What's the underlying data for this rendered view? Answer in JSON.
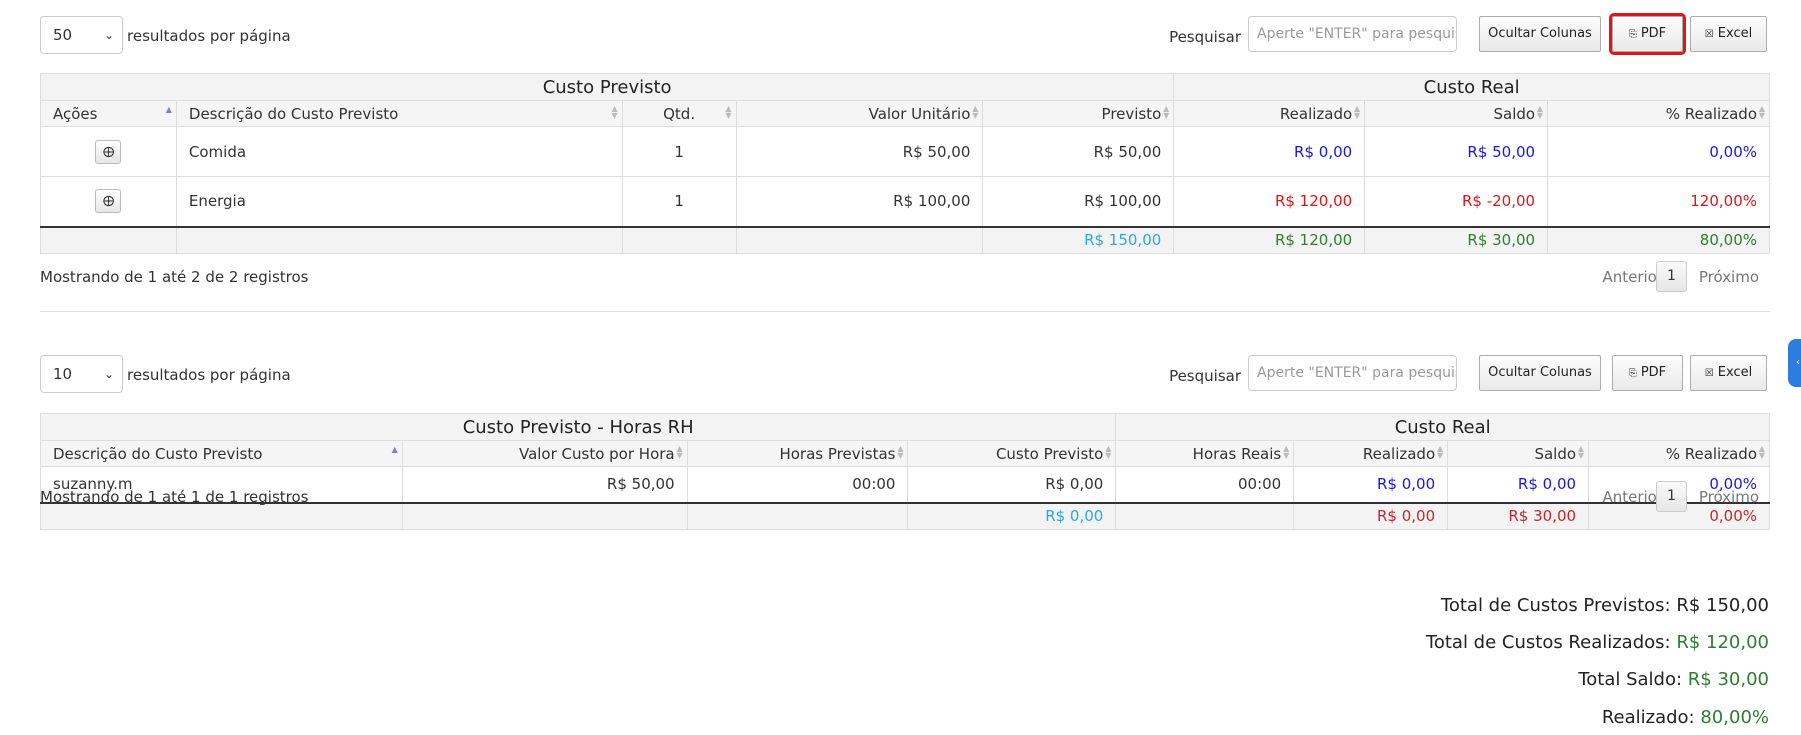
{
  "table1": {
    "page_size": "50",
    "per_page_label": "resultados por página",
    "search_label": "Pesquisar",
    "search_placeholder": "Aperte \"ENTER\" para pesquisar",
    "btn_hide_cols": "Ocultar Colunas",
    "btn_pdf": "PDF",
    "btn_excel": "Excel",
    "group_headers": [
      "Custo Previsto",
      "Custo Real"
    ],
    "columns": [
      "Ações",
      "Descrição do Custo Previsto",
      "Qtd.",
      "Valor Unitário",
      "Previsto",
      "Realizado",
      "Saldo",
      "% Realizado"
    ],
    "rows": [
      {
        "desc": "Comida",
        "qtd": "1",
        "unit": "R$ 50,00",
        "previsto": "R$ 50,00",
        "realizado": "R$ 0,00",
        "saldo": "R$ 50,00",
        "pct": "0,00%"
      },
      {
        "desc": "Energia",
        "qtd": "1",
        "unit": "R$ 100,00",
        "previsto": "R$ 100,00",
        "realizado": "R$ 120,00",
        "saldo": "R$ -20,00",
        "pct": "120,00%"
      }
    ],
    "footer": {
      "previsto": "R$ 150,00",
      "realizado": "R$ 120,00",
      "saldo": "R$ 30,00",
      "pct": "80,00%"
    },
    "info": "Mostrando de 1 até 2 de 2 registros",
    "pager": {
      "prev": "Anterior",
      "page": "1",
      "next": "Próximo"
    }
  },
  "table2": {
    "page_size": "10",
    "per_page_label": "resultados por página",
    "search_label": "Pesquisar",
    "search_placeholder": "Aperte \"ENTER\" para pesquisar",
    "btn_hide_cols": "Ocultar Colunas",
    "btn_pdf": "PDF",
    "btn_excel": "Excel",
    "group_headers": [
      "Custo Previsto - Horas RH",
      "Custo Real"
    ],
    "columns": [
      "Descrição do Custo Previsto",
      "Valor Custo por Hora",
      "Horas Previstas",
      "Custo Previsto",
      "Horas Reais",
      "Realizado",
      "Saldo",
      "% Realizado"
    ],
    "rows": [
      {
        "desc": "suzanny.m",
        "valor_hora": "R$ 50,00",
        "horas_prev": "00:00",
        "custo_prev": "R$ 0,00",
        "horas_reais": "00:00",
        "realizado": "R$ 0,00",
        "saldo": "R$ 0,00",
        "pct": "0,00%"
      }
    ],
    "footer": {
      "custo_prev": "R$ 0,00",
      "realizado": "R$ 0,00",
      "saldo": "R$ 30,00",
      "pct": "0,00%"
    },
    "info": "Mostrando de 1 até 1 de 1 registros",
    "pager": {
      "prev": "Anterior",
      "page": "1",
      "next": "Próximo"
    }
  },
  "totals": {
    "previstos_label": "Total de Custos Previstos:",
    "previstos_value": "R$ 150,00",
    "realizados_label": "Total de Custos Realizados:",
    "realizados_value": "R$ 120,00",
    "saldo_label": "Total Saldo:",
    "saldo_value": "R$ 30,00",
    "realizado_label": "Realizado:",
    "realizado_value": "80,00%"
  },
  "icons": {
    "pdf": "file-pdf-icon",
    "excel": "file-excel-icon",
    "row_action": "plus-circle-icon",
    "side_tab": "chevron-icon"
  },
  "colors": {
    "positive": "#2f7d32",
    "negative": "#e0141a",
    "neutral": "#1818e6",
    "total_previsto": "#29a8e6",
    "highlight": "#e0141a"
  }
}
